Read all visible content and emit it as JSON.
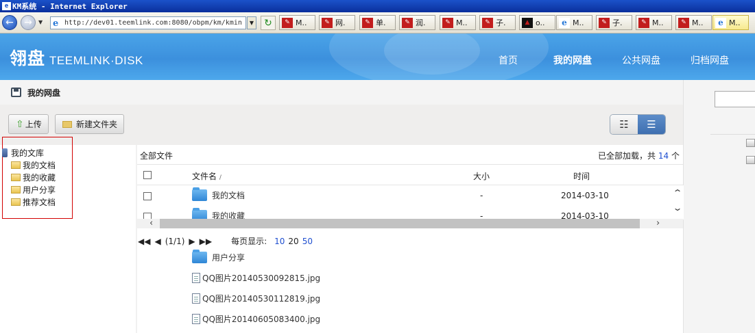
{
  "window": {
    "title": "KM系统 - Internet Explorer",
    "ie_badge": "e"
  },
  "browser": {
    "address": "http://dev01.teemlink.com:8080/obpm/km/kmin",
    "tabs": [
      {
        "label": "M..",
        "icon": "app-icon"
      },
      {
        "label": "网.",
        "icon": "app-icon"
      },
      {
        "label": "单.",
        "icon": "app-icon"
      },
      {
        "label": "润.",
        "icon": "app-icon"
      },
      {
        "label": "M..",
        "icon": "app-icon"
      },
      {
        "label": "子.",
        "icon": "app-icon"
      },
      {
        "label": "o..",
        "icon": "dark-app-icon"
      },
      {
        "label": "M..",
        "icon": "ie-icon"
      },
      {
        "label": "子.",
        "icon": "app-icon"
      },
      {
        "label": "M..",
        "icon": "app-icon"
      },
      {
        "label": "M..",
        "icon": "app-icon"
      },
      {
        "label": "M..",
        "icon": "ie-icon"
      }
    ]
  },
  "app": {
    "logo_cn": "翎盘",
    "logo_en": "TEEMLINK·DISK",
    "nav": [
      "首页",
      "我的网盘",
      "公共网盘",
      "归档网盘"
    ],
    "active_nav": "我的网盘"
  },
  "page": {
    "title": "我的网盘"
  },
  "toolbar": {
    "upload": "上传",
    "new_folder": "新建文件夹"
  },
  "tree": {
    "root": "我的文库",
    "items": [
      "我的文档",
      "我的收藏",
      "用户分享",
      "推荐文档"
    ]
  },
  "list": {
    "breadcrumb": "全部文件",
    "loaded_prefix": "已全部加载，共",
    "loaded_count": "14",
    "loaded_suffix": "个",
    "columns": {
      "name": "文件名",
      "sort_mark": "/",
      "size": "大小",
      "time": "时间"
    },
    "rows": [
      {
        "name": "我的文档",
        "size": "-",
        "time": "2014-03-10"
      },
      {
        "name": "我的收藏",
        "size": "-",
        "time": "2014-03-10"
      }
    ],
    "overflow_rows": [
      "用户分享",
      "QQ图片20140530092815.jpg",
      "QQ图片20140530112819.jpg",
      "QQ图片20140605083400.jpg"
    ]
  },
  "pager": {
    "page_info": "(1/1)",
    "per_page_label": "每页显示:",
    "sizes": [
      "10",
      "20",
      "50"
    ]
  },
  "colors": {
    "header": "#3f93de",
    "accent": "#1f4fd0",
    "tree_border": "#d20000"
  }
}
